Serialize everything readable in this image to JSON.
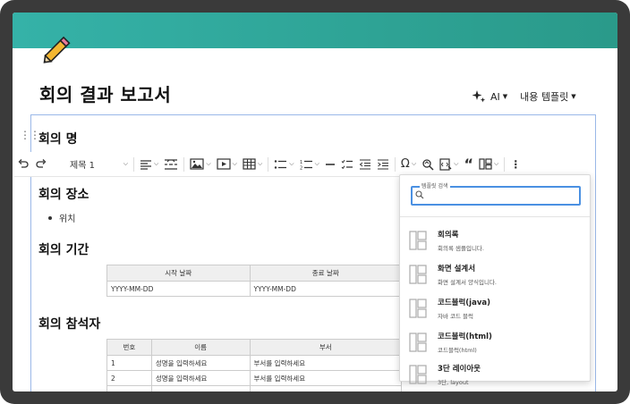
{
  "document": {
    "title": "회의 결과 보고서"
  },
  "header_actions": {
    "ai_label": "AI",
    "template_label": "내용 템플릿"
  },
  "toolbar": {
    "heading_select": "제목 1"
  },
  "sections": {
    "meeting_name": "회의 명",
    "meeting_place": "회의 장소",
    "place_bullet": "위치",
    "meeting_period": "회의 기간",
    "attendees": "회의 참석자"
  },
  "period_table": {
    "headers": [
      "시작 날짜",
      "종료 날짜"
    ],
    "row": [
      "YYYY-MM-DD",
      "YYYY-MM-DD"
    ]
  },
  "attendee_table": {
    "headers": [
      "번호",
      "이름",
      "부서"
    ],
    "rows": [
      [
        "1",
        "성명을 입력하세요",
        "부서를 입력하세요"
      ],
      [
        "2",
        "성명을 입력하세요",
        "부서를 입력하세요"
      ],
      [
        "",
        "",
        ""
      ]
    ]
  },
  "template_dropdown": {
    "search_label": "템플릿 검색",
    "search_value": "",
    "items": [
      {
        "title": "회의록",
        "desc": "회의록 샘플입니다."
      },
      {
        "title": "화면 설계서",
        "desc": "화면 설계서 양식입니다."
      },
      {
        "title": "코드블럭(java)",
        "desc": "자바 코드 블럭"
      },
      {
        "title": "코드블럭(html)",
        "desc": "코드블럭(html)"
      },
      {
        "title": "3단 레이아웃",
        "desc": "3단, layout"
      }
    ]
  },
  "colors": {
    "banner": "#2ea395",
    "focus": "#4a90e2",
    "frame": "#3a3a3a"
  }
}
